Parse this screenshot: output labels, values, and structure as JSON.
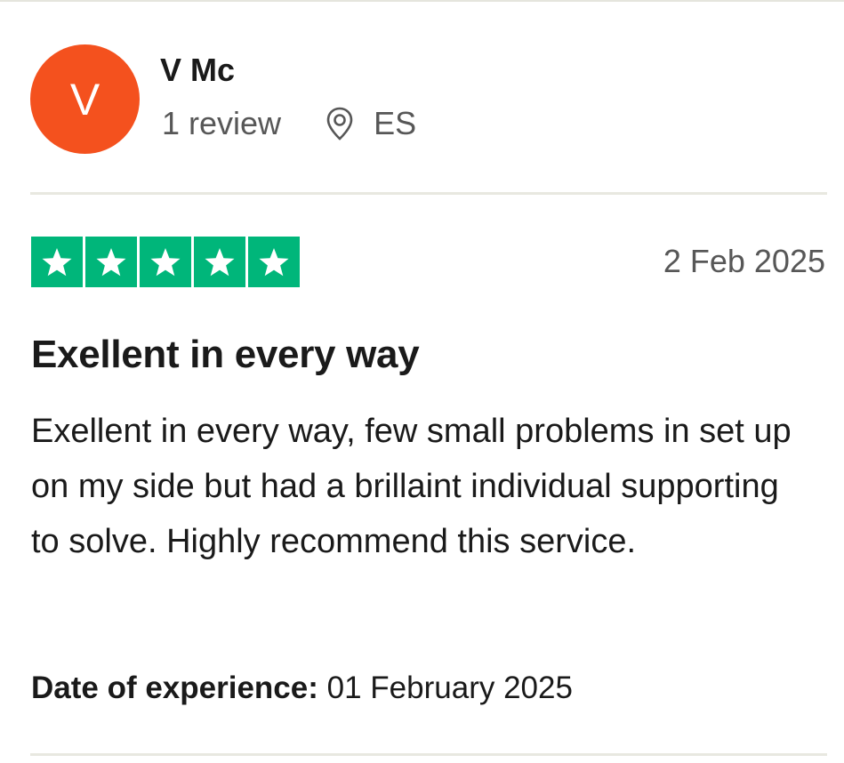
{
  "reviewer": {
    "initial": "V",
    "name": "V Mc",
    "review_count": "1 review",
    "country": "ES",
    "avatar_color": "#f4511e"
  },
  "review": {
    "rating": 5,
    "rating_max": 5,
    "star_color": "#00b67a",
    "date": "2 Feb 2025",
    "title": "Exellent in every way",
    "body": "Exellent in every way, few small problems in set up on my side but had a brillaint individual supporting to solve. Highly recommend this service.",
    "experience_label": "Date of experience:",
    "experience_date": "01 February 2025"
  }
}
